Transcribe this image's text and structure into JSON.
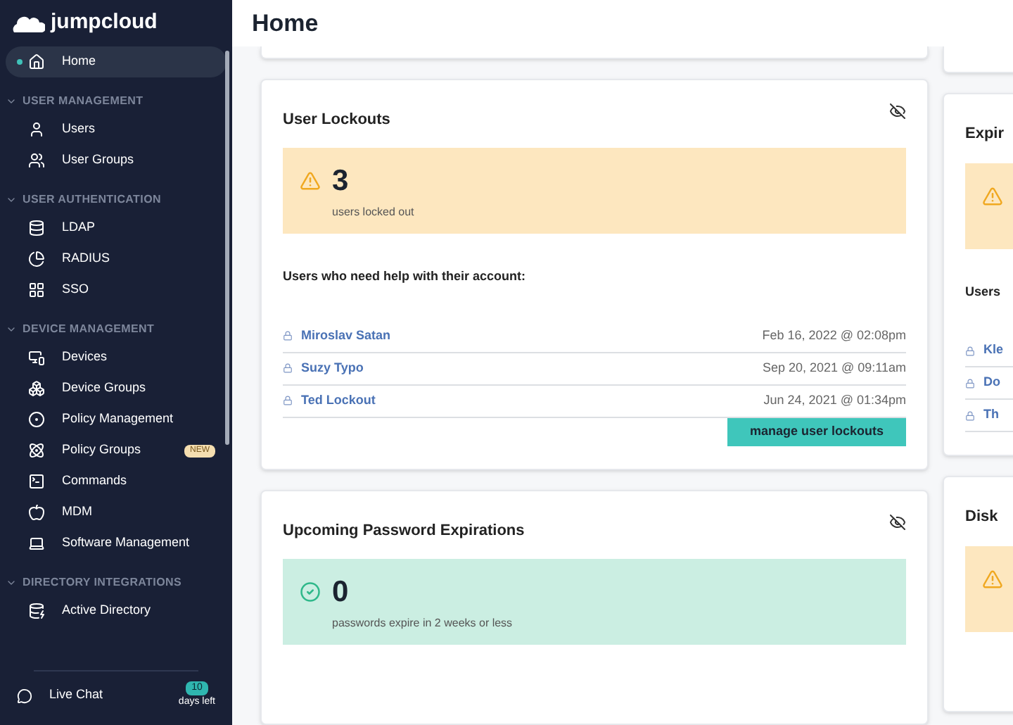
{
  "sidebar": {
    "logo": "jumpcloud",
    "top_items": [
      {
        "label": "Home",
        "selected": true
      }
    ],
    "sections": [
      {
        "title": "USER MANAGEMENT",
        "expanded": true,
        "items": [
          {
            "label": "Users",
            "selected": false
          },
          {
            "label": "User Groups",
            "selected": false
          }
        ]
      },
      {
        "title": "USER AUTHENTICATION",
        "expanded": true,
        "items": [
          {
            "label": "LDAP",
            "selected": false
          },
          {
            "label": "RADIUS",
            "selected": false
          },
          {
            "label": "SSO",
            "selected": false
          }
        ]
      },
      {
        "title": "DEVICE MANAGEMENT",
        "expanded": true,
        "items": [
          {
            "label": "Devices",
            "selected": false
          },
          {
            "label": "Device Groups",
            "selected": false
          },
          {
            "label": "Policy Management",
            "selected": false
          },
          {
            "label": "Policy Groups",
            "selected": false,
            "badge": "NEW"
          },
          {
            "label": "Commands",
            "selected": false
          },
          {
            "label": "MDM",
            "selected": false
          },
          {
            "label": "Software Management",
            "selected": false
          }
        ]
      },
      {
        "title": "DIRECTORY INTEGRATIONS",
        "expanded": true,
        "items": [
          {
            "label": "Active Directory",
            "selected": false
          }
        ]
      }
    ],
    "footer": {
      "label": "Live Chat",
      "trial_count": "10",
      "trial_text": "days left"
    }
  },
  "header": {
    "title": "Home"
  },
  "columns": [
    [
      {
        "title": "User Lockouts",
        "kind": "warning",
        "count": "3",
        "caption": "users locked out",
        "list_title": "Users who need help with their account:",
        "rows": [
          {
            "name": "Miroslav Satan",
            "time": "Feb 16, 2022 @ 02:08pm"
          },
          {
            "name": "Suzy Typo",
            "time": "Sep 20, 2021 @ 09:11am"
          },
          {
            "name": "Ted Lockout",
            "time": "Jun 24, 2021 @ 01:34pm"
          }
        ],
        "action": "manage user lockouts"
      },
      {
        "title": "Upcoming Password Expirations",
        "kind": "success",
        "count": "0",
        "caption": "passwords expire in 2 weeks or less"
      }
    ],
    [
      {
        "title": "Expir",
        "kind": "warning",
        "list_title": "Users",
        "rows": [
          {
            "name": "Kle"
          },
          {
            "name": "Do"
          },
          {
            "name": "Th"
          }
        ]
      },
      {
        "title": "Disk",
        "kind": "warning"
      }
    ]
  ]
}
